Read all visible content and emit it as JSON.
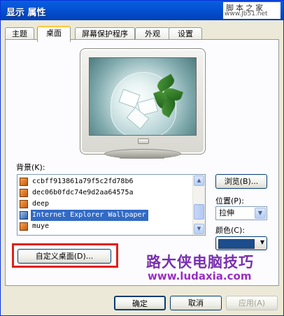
{
  "window": {
    "title": "显示 属性"
  },
  "watermark": {
    "top": "脚本之家",
    "bottom": "www.Jb51.net"
  },
  "tabs": [
    {
      "label": "主题"
    },
    {
      "label": "桌面"
    },
    {
      "label": "屏幕保护程序"
    },
    {
      "label": "外观"
    },
    {
      "label": "设置"
    }
  ],
  "desktop": {
    "background_label": "背景(K):",
    "background_items": [
      "ccbff913861a79f5c2fd78b6",
      "dec06b0fdc74e9d2aa64575a",
      "deep",
      "Internet Explorer Wallpaper",
      "muye"
    ],
    "selected_background": "Internet Explorer Wallpaper",
    "browse_button": "浏览(B)...",
    "position_label": "位置(P):",
    "position_value": "拉伸",
    "color_label": "颜色(C):",
    "color_value": "#1c4e8e",
    "customize_button": "自定义桌面(D)..."
  },
  "promo": {
    "title": "路大侠电脑技巧",
    "url": "www.ludaxia.com"
  },
  "footer": {
    "ok": "确定",
    "cancel": "取消",
    "apply": "应用(A)"
  },
  "colors": {
    "title_bar": "#0453d4",
    "selection": "#316ac5",
    "highlight_border": "#e0201c"
  }
}
